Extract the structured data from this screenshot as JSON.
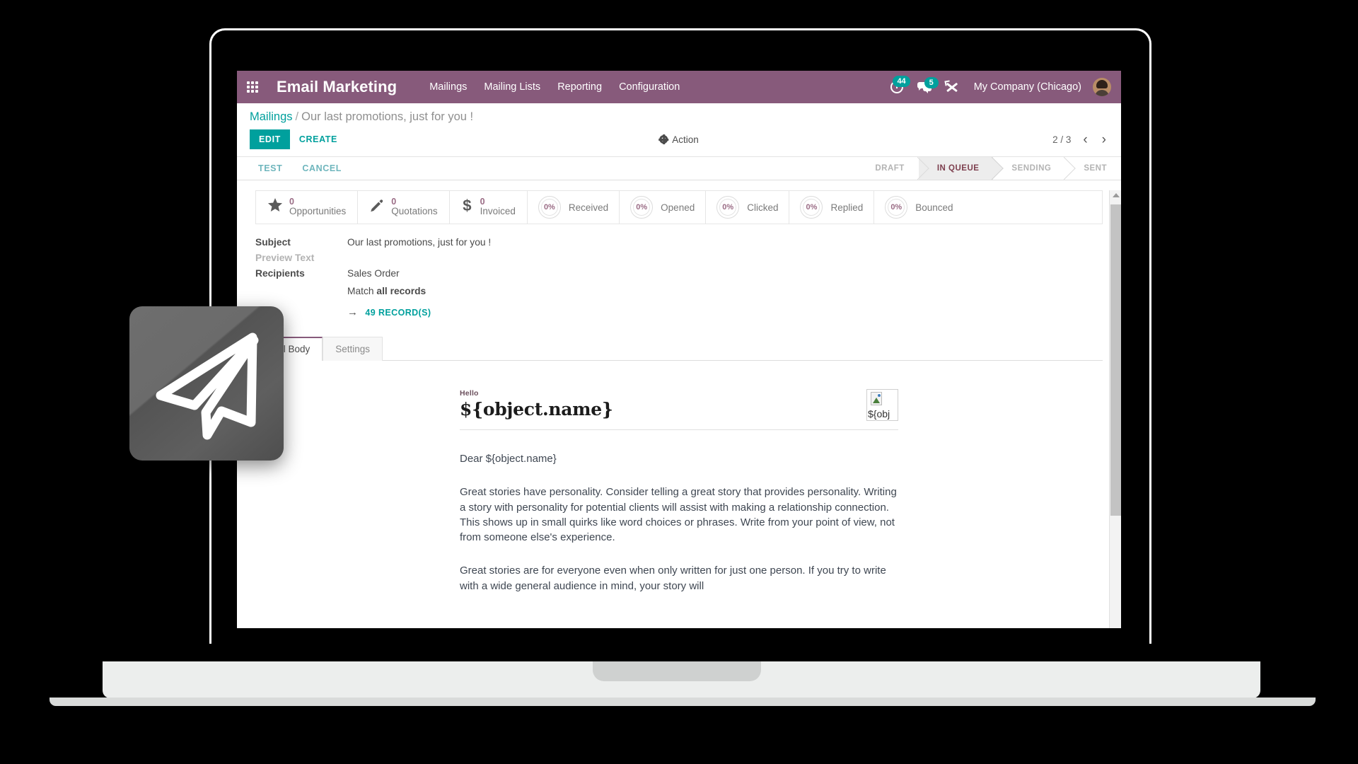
{
  "topbar": {
    "apps_icon": "apps-grid-icon",
    "app_title": "Email Marketing",
    "menu": [
      {
        "label": "Mailings"
      },
      {
        "label": "Mailing Lists"
      },
      {
        "label": "Reporting"
      },
      {
        "label": "Configuration"
      }
    ],
    "activity_icon": "clock-icon",
    "activity_badge": "44",
    "messages_icon": "chat-icon",
    "messages_badge": "5",
    "tools_icon": "tools-icon",
    "company": "My Company (Chicago)",
    "avatar": "user-avatar",
    "bg_color": "#875a7b",
    "badge_color": "#00a09d"
  },
  "control_panel": {
    "breadcrumb_root": "Mailings",
    "breadcrumb_sep": "/",
    "breadcrumb_current": "Our last promotions, just for you !",
    "edit_label": "EDIT",
    "create_label": "CREATE",
    "action_label": "Action",
    "pager_value": "2 / 3",
    "prev_glyph": "‹",
    "next_glyph": "›",
    "accent_color": "#00a09d"
  },
  "statusbar": {
    "test_label": "TEST",
    "cancel_label": "CANCEL",
    "stages": [
      {
        "label": "DRAFT",
        "active": false
      },
      {
        "label": "IN QUEUE",
        "active": true
      },
      {
        "label": "SENDING",
        "active": false
      },
      {
        "label": "SENT",
        "active": false
      }
    ],
    "active_color": "#7d3f4e"
  },
  "stat_buttons": [
    {
      "icon": "star-icon",
      "value": "0",
      "label": "Opportunities",
      "kind": "icon"
    },
    {
      "icon": "pencil-icon",
      "value": "0",
      "label": "Quotations",
      "kind": "icon"
    },
    {
      "icon": "dollar-icon",
      "value": "0",
      "label": "Invoiced",
      "kind": "icon"
    },
    {
      "icon": "ring-gauge",
      "value": "0%",
      "label": "Received",
      "kind": "ring"
    },
    {
      "icon": "ring-gauge",
      "value": "0%",
      "label": "Opened",
      "kind": "ring"
    },
    {
      "icon": "ring-gauge",
      "value": "0%",
      "label": "Clicked",
      "kind": "ring"
    },
    {
      "icon": "ring-gauge",
      "value": "0%",
      "label": "Replied",
      "kind": "ring"
    },
    {
      "icon": "ring-gauge",
      "value": "0%",
      "label": "Bounced",
      "kind": "ring"
    }
  ],
  "form": {
    "subject_label": "Subject",
    "subject_value": "Our last promotions, just for you !",
    "preview_label": "Preview Text",
    "preview_value": "",
    "recipients_label": "Recipients",
    "recipients_value": "Sales Order",
    "match_prefix": "Match ",
    "match_bold": "all records",
    "records_arrow": "→",
    "records_link": "49 RECORD(S)"
  },
  "notebook": {
    "tabs": [
      {
        "label": "Mail Body",
        "active": true
      },
      {
        "label": "Settings",
        "active": false
      }
    ]
  },
  "mail": {
    "hello": "Hello",
    "heading": "${object.name}",
    "image_alt": "${obj",
    "salutation": "Dear ${object.name}",
    "paragraph_1": "Great stories have personality. Consider telling a great story that provides personality. Writing a story with personality for potential clients will assist with making a relationship connection. This shows up in small quirks like word choices or phrases. Write from your point of view, not from someone else's experience.",
    "paragraph_2": "Great stories are for everyone even when only written for just one person. If you try to write with a wide general audience in mind, your story will"
  },
  "scrollbar": {
    "up_arrow": "scroll-up-arrow"
  },
  "app_logo": {
    "name": "email-marketing-paper-plane-logo"
  }
}
